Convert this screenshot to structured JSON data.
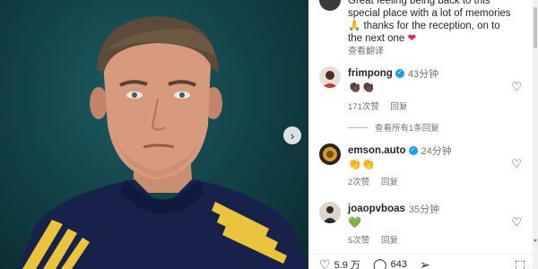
{
  "photo": {
    "next_icon": "chevron-right-icon",
    "next_glyph": "›",
    "colors": {
      "background": "#134449",
      "jacket": "#17214a",
      "stripe": "#e9c43c"
    }
  },
  "caption": {
    "lines": [
      "Great feeling being back to this",
      "special place with a lot of memories",
      "🙏 thanks for the reception, on to",
      "the next one"
    ],
    "emoji_end": "❤",
    "translate_label": "查看翻译"
  },
  "comments": [
    {
      "user": "frimpong",
      "verified": true,
      "time": "43分钟",
      "text": "👏🏿👏🏿",
      "likes": "171次赞",
      "reply_label": "回复"
    },
    {
      "user": "emson.auto",
      "verified": true,
      "time": "24分钟",
      "text": "👏👏",
      "likes": "2次赞",
      "reply_label": "回复"
    },
    {
      "user": "joaopvboas",
      "verified": false,
      "time": "35分钟",
      "text": "💚",
      "likes": "5次赞",
      "reply_label": "回复"
    }
  ],
  "view_replies_label": "查看所有1条回复",
  "actions": {
    "likes_count": "5.9 万",
    "comments_count": "643",
    "like_icon": "heart-outline-icon",
    "comment_icon": "comment-bubble-icon",
    "share_icon": "share-icon",
    "bookmark_icon": "bookmark-icon"
  },
  "colors": {
    "verified": "#1d9bf0",
    "heart": "#e0245e",
    "muted": "#737373"
  }
}
